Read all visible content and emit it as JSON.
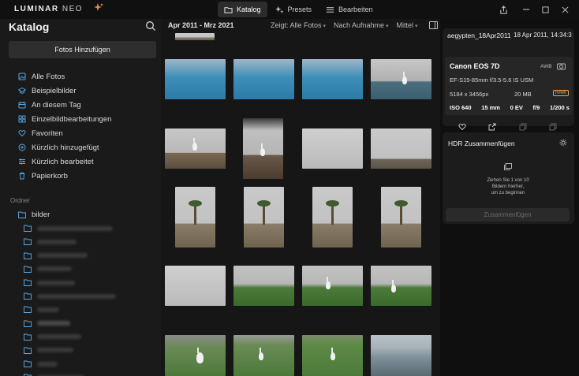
{
  "app": {
    "logo_main": "LUMINAR",
    "logo_sub": "NEO"
  },
  "modes": [
    {
      "label": "Katalog",
      "icon": "folder-icon",
      "active": true
    },
    {
      "label": "Presets",
      "icon": "sparkle-icon",
      "active": false
    },
    {
      "label": "Bearbeiten",
      "icon": "sliders-icon",
      "active": false
    }
  ],
  "sidebar": {
    "title": "Katalog",
    "add_button": "Fotos Hinzufügen",
    "items": [
      {
        "label": "Alle Fotos",
        "icon": "photos-icon"
      },
      {
        "label": "Beispielbilder",
        "icon": "graduation-cap-icon"
      },
      {
        "label": "An diesem Tag",
        "icon": "calendar-icon"
      },
      {
        "label": "Einzelbildbearbeitungen",
        "icon": "grid-icon"
      },
      {
        "label": "Favoriten",
        "icon": "heart-icon"
      },
      {
        "label": "Kürzlich hinzugefügt",
        "icon": "plus-circle-icon"
      },
      {
        "label": "Kürzlich bearbeitet",
        "icon": "sliders-icon"
      },
      {
        "label": "Papierkorb",
        "icon": "trash-icon"
      }
    ],
    "folders_label": "Ordner",
    "root_folder": "bilder"
  },
  "toolbar": {
    "date_range": "Apr 2011 - Mrz 2021",
    "filter_show": "Zeigt: Alle Fotos",
    "filter_sort": "Nach Aufnahme",
    "filter_size": "Mittel"
  },
  "info": {
    "filename": "aegypten_18Apr2011",
    "datetime": "18 Apr 2011, 14:34:35",
    "camera": "Canon EOS 7D",
    "awb": "AWB",
    "lens": "EF-S15-85mm f/3.5-5.6 IS USM",
    "dimensions": "5184 x 3456px",
    "filesize": "20 MB",
    "raw_badge": "RAW",
    "iso": "ISO 640",
    "focal": "15 mm",
    "ev": "0 EV",
    "aperture": "f/9",
    "shutter": "1/200 s"
  },
  "hdr": {
    "title": "HDR Zusammenfügen",
    "drop_line1": "Ziehen Sie 1 von 10",
    "drop_line2": "Bildern hierher,",
    "drop_line3": "um zu beginnen",
    "merge_button": "Zusammenfügen"
  },
  "colors": {
    "raw": "#f0a44a",
    "active_mode": "#2c2c2c"
  }
}
